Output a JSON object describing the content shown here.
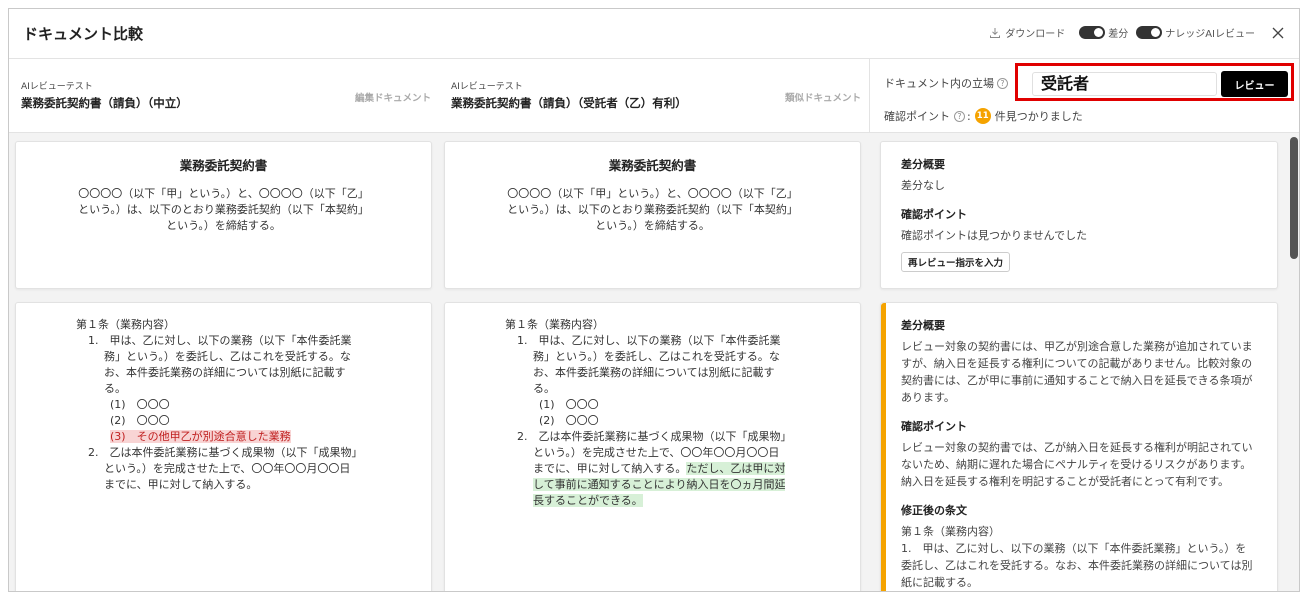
{
  "header": {
    "title": "ドキュメント比較",
    "download_label": "ダウンロード",
    "diff_label": "差分",
    "knowledge_label": "ナレッジAIレビュー"
  },
  "docs": [
    {
      "sub": "AIレビューテスト",
      "name": "業務委託契約書（請負）（中立）",
      "tag": "編集ドキュメント",
      "title": "業務委託契約書",
      "preamble": "〇〇〇〇（以下「甲」という。）と、〇〇〇〇（以下「乙」という。）は、以下のとおり業務委託契約（以下「本契約」という。）を締結する。",
      "article": {
        "heading": "第１条（業務内容）",
        "p1a": "1.　甲は、乙に対し、以下の業務（以下「本件委託業",
        "p1b": "務」という。）を委託し、乙はこれを受託する。な",
        "p1c": "お、本件委託業務の詳細については別紙に記載す",
        "p1d": "る。",
        "i1": "(1)　〇〇〇",
        "i2": "(2)　〇〇〇",
        "i3": "(3)　その他甲乙が別途合意した業務",
        "p2a": "2.　乙は本件委託業務に基づく成果物（以下「成果物」",
        "p2b": "という。）を完成させた上で、〇〇年〇〇月〇〇日",
        "p2c": "までに、甲に対して納入する。"
      }
    },
    {
      "sub": "AIレビューテスト",
      "name": "業務委託契約書（請負）（受託者（乙）有利）",
      "tag": "類似ドキュメント",
      "title": "業務委託契約書",
      "preamble": "〇〇〇〇（以下「甲」という。）と、〇〇〇〇（以下「乙」という。）は、以下のとおり業務委託契約（以下「本契約」という。）を締結する。",
      "article": {
        "heading": "第１条（業務内容）",
        "p1a": "1.　甲は、乙に対し、以下の業務（以下「本件委託業",
        "p1b": "務」という。）を委託し、乙はこれを受託する。な",
        "p1c": "お、本件委託業務の詳細については別紙に記載す",
        "p1d": "る。",
        "i1": "(1)　〇〇〇",
        "i2": "(2)　〇〇〇",
        "p2a": "2.　乙は本件委託業務に基づく成果物（以下「成果物」",
        "p2b": "という。）を完成させた上で、〇〇年〇〇月〇〇日",
        "p2c1": "までに、甲に対して納入する。",
        "p2c2": "ただし、乙は甲に対",
        "p2d": "して事前に通知することにより納入日を〇ヵ月間延",
        "p2e": "長することができる。"
      }
    }
  ],
  "review": {
    "position_label": "ドキュメント内の立場",
    "position_value": "受託者",
    "review_button": "レビュー",
    "points_count": "11",
    "points_suffix": "件見つかりました",
    "points_label": "確認ポイント",
    "card1": {
      "summary_h": "差分概要",
      "summary_t": "差分なし",
      "points_h": "確認ポイント",
      "points_t": "確認ポイントは見つかりませんでした",
      "reinput": "再レビュー指示を入力"
    },
    "card2": {
      "summary_h": "差分概要",
      "summary_t": "レビュー対象の契約書には、甲乙が別途合意した業務が追加されていますが、納入日を延長する権利についての記載がありません。比較対象の契約書には、乙が甲に事前に通知することで納入日を延長できる条項があります。",
      "points_h": "確認ポイント",
      "points_t": "レビュー対象の契約書では、乙が納入日を延長する権利が明記されていないため、納期に遅れた場合にペナルティを受けるリスクがあります。納入日を延長する権利を明記することが受託者にとって有利です。",
      "revised_h": "修正後の条文",
      "revised_t1": "第１条（業務内容）",
      "revised_t2": "1.　甲は、乙に対し、以下の業務（以下「本件委託業務」という。）を委託し、乙はこれを受託する。なお、本件委託業務の詳細については別紙に記載する。"
    }
  }
}
